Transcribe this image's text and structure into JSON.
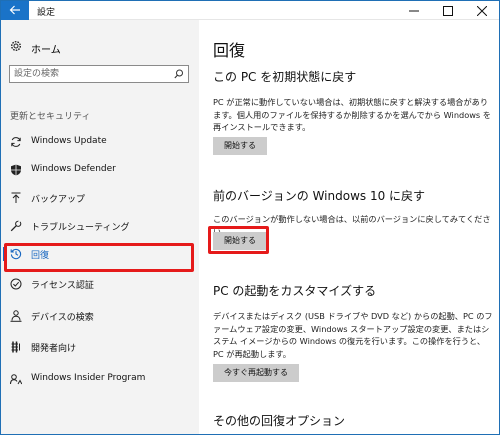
{
  "window": {
    "title": "設定"
  },
  "sidebar": {
    "home_label": "ホーム",
    "search_placeholder": "設定の検索",
    "section_label": "更新とセキュリティ",
    "items": [
      {
        "label": "Windows Update",
        "icon": "refresh-icon"
      },
      {
        "label": "Windows Defender",
        "icon": "shield-icon"
      },
      {
        "label": "バックアップ",
        "icon": "upload-arrow-icon"
      },
      {
        "label": "トラブルシューティング",
        "icon": "wrench-icon"
      },
      {
        "label": "回復",
        "icon": "history-icon",
        "active": true
      },
      {
        "label": "ライセンス認証",
        "icon": "check-circle-icon"
      },
      {
        "label": "デバイスの検索",
        "icon": "person-pin-icon"
      },
      {
        "label": "開発者向け",
        "icon": "developer-icon"
      },
      {
        "label": "Windows Insider Program",
        "icon": "insider-icon"
      }
    ]
  },
  "main": {
    "title": "回復",
    "sections": [
      {
        "heading": "この PC を初期状態に戻す",
        "description": "PC が正常に動作していない場合は、初期状態に戻すと解決する場合があります。個人用のファイルを保持するか削除するかを選んでから Windows を再インストールできます。",
        "button": "開始する"
      },
      {
        "heading": "前のバージョンの Windows 10 に戻す",
        "description": "このバージョンが動作しない場合は、以前のバージョンに戻してみてください。",
        "button": "開始する"
      },
      {
        "heading": "PC の起動をカスタマイズする",
        "description": "デバイスまたはディスク (USB ドライブや DVD など) からの起動、PC のファームウェア設定の変更、Windows スタートアップ設定の変更、またはシステム イメージからの Windows の復元を行います。この操作を行うと、PC が再起動します。",
        "button": "今すぐ再起動する"
      },
      {
        "heading": "その他の回復オプション"
      }
    ]
  },
  "colors": {
    "accent": "#1a73c8",
    "highlight": "#e51a1a",
    "active_text": "#1565c0"
  }
}
